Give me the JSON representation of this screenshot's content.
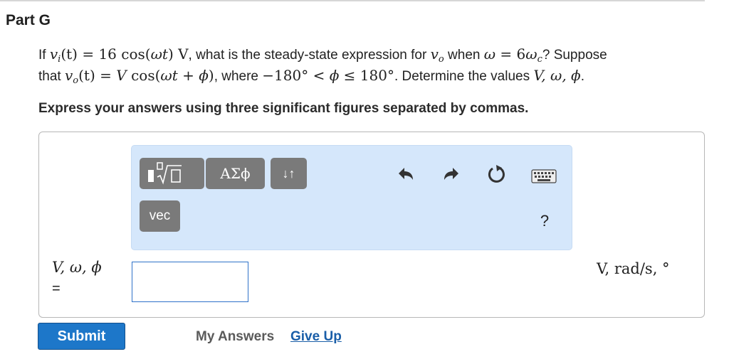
{
  "part": {
    "title": "Part G"
  },
  "question": {
    "l1_if": "If ",
    "l1_vi_v": "v",
    "l1_vi_sub": "i",
    "l1_vi_arg": "(t)",
    "l1_eq_rhs": " = 16 cos(",
    "l1_wt": "ωt",
    "l1_rparen_V": ") V",
    "l1_mid": ", what is the steady-state expression for ",
    "l1_vo_v": "v",
    "l1_vo_sub": "o",
    "l1_when": " when ",
    "l1_omega": "ω",
    "l1_eq6": " = 6",
    "l1_omega_c": "ω",
    "l1_c_sub": "c",
    "l1_tail": "? Suppose",
    "l2_that": "that ",
    "l2_vo_v": "v",
    "l2_vo_sub": "o",
    "l2_arg": "(t)",
    "l2_eq": " = ",
    "l2_V": "V",
    "l2_cos": " cos(",
    "l2_wt": "ωt",
    "l2_plus": " + ",
    "l2_phi": "ϕ",
    "l2_close": ")",
    "l2_where": ", where ",
    "l2_range_a": "−180° < ",
    "l2_phi2": "ϕ",
    "l2_range_b": " ≤ 180°",
    "l2_det": ". Determine the values ",
    "l2_vals": "V, ω, ϕ",
    "l2_end": "."
  },
  "instruction": "Express your answers using three significant figures separated by commas.",
  "toolbar": {
    "greek_label": "ΑΣϕ",
    "arrows_label": "↓↑",
    "vec_label": "vec",
    "help_label": "?"
  },
  "answer": {
    "variables_label": "V, ω, ϕ",
    "equals": "=",
    "value": "",
    "units": "V, rad/s, °"
  },
  "actions": {
    "submit": "Submit",
    "my_answers": "My Answers",
    "give_up": "Give Up"
  },
  "icons": {
    "templates": "fraction-sqrt-template-icon",
    "undo": "undo-icon",
    "redo": "redo-icon",
    "reset": "reset-icon",
    "keyboard": "keyboard-icon"
  },
  "colors": {
    "toolbar_bg": "#d5e7fb",
    "button_gray": "#7a7a7a",
    "submit_blue": "#1d77c9",
    "link_blue": "#1a5ea8",
    "input_border": "#2f72c9"
  }
}
